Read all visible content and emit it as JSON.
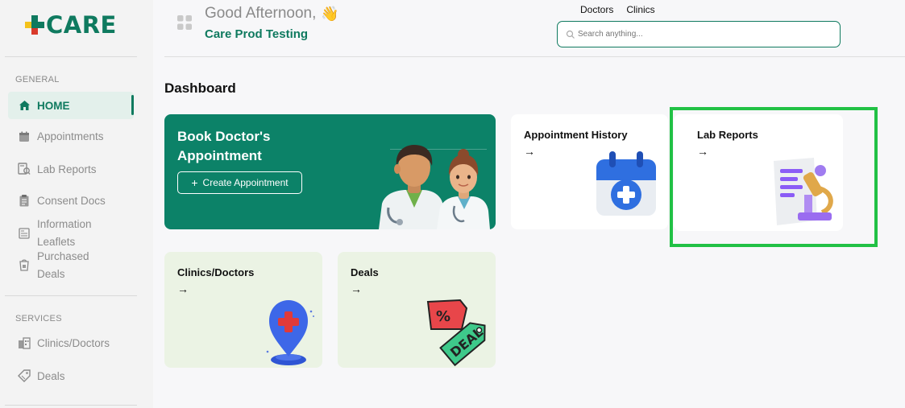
{
  "brand": {
    "name": "CARE"
  },
  "sidebar": {
    "general_label": "GENERAL",
    "services_label": "SERVICES",
    "items": [
      {
        "label": "HOME",
        "icon": "home-icon"
      },
      {
        "label": "Appointments",
        "icon": "calendar-icon"
      },
      {
        "label": "Lab Reports",
        "icon": "lab-report-icon"
      },
      {
        "label": "Consent Docs",
        "icon": "clipboard-icon"
      },
      {
        "label": "Information Leaflets",
        "icon": "leaflet-icon"
      },
      {
        "label": "Purchased Deals",
        "icon": "purchased-icon"
      }
    ],
    "service_items": [
      {
        "label": "Clinics/Doctors",
        "icon": "building-icon"
      },
      {
        "label": "Deals",
        "icon": "tag-icon"
      }
    ]
  },
  "header": {
    "greeting": "Good Afternoon,",
    "greeting_emoji": "👋",
    "organization": "Care Prod Testing",
    "tabs": [
      "Doctors",
      "Clinics"
    ],
    "search_placeholder": "Search anything..."
  },
  "main": {
    "title": "Dashboard",
    "book_card": {
      "title": "Book Doctor's Appointment",
      "button_label": "Create Appointment",
      "button_icon": "+"
    },
    "appointment_history": {
      "title": "Appointment History",
      "arrow": "→"
    },
    "lab_reports": {
      "title": "Lab Reports",
      "arrow": "→"
    },
    "clinics_doctors": {
      "title": "Clinics/Doctors",
      "arrow": "→"
    },
    "deals": {
      "title": "Deals",
      "arrow": "→",
      "badge_text": "DEAL",
      "percent": "%"
    }
  },
  "colors": {
    "brand_green": "#0f7a5f",
    "card_green": "#0c8268",
    "light_green": "#ebf3e4",
    "highlight": "#21c145"
  }
}
